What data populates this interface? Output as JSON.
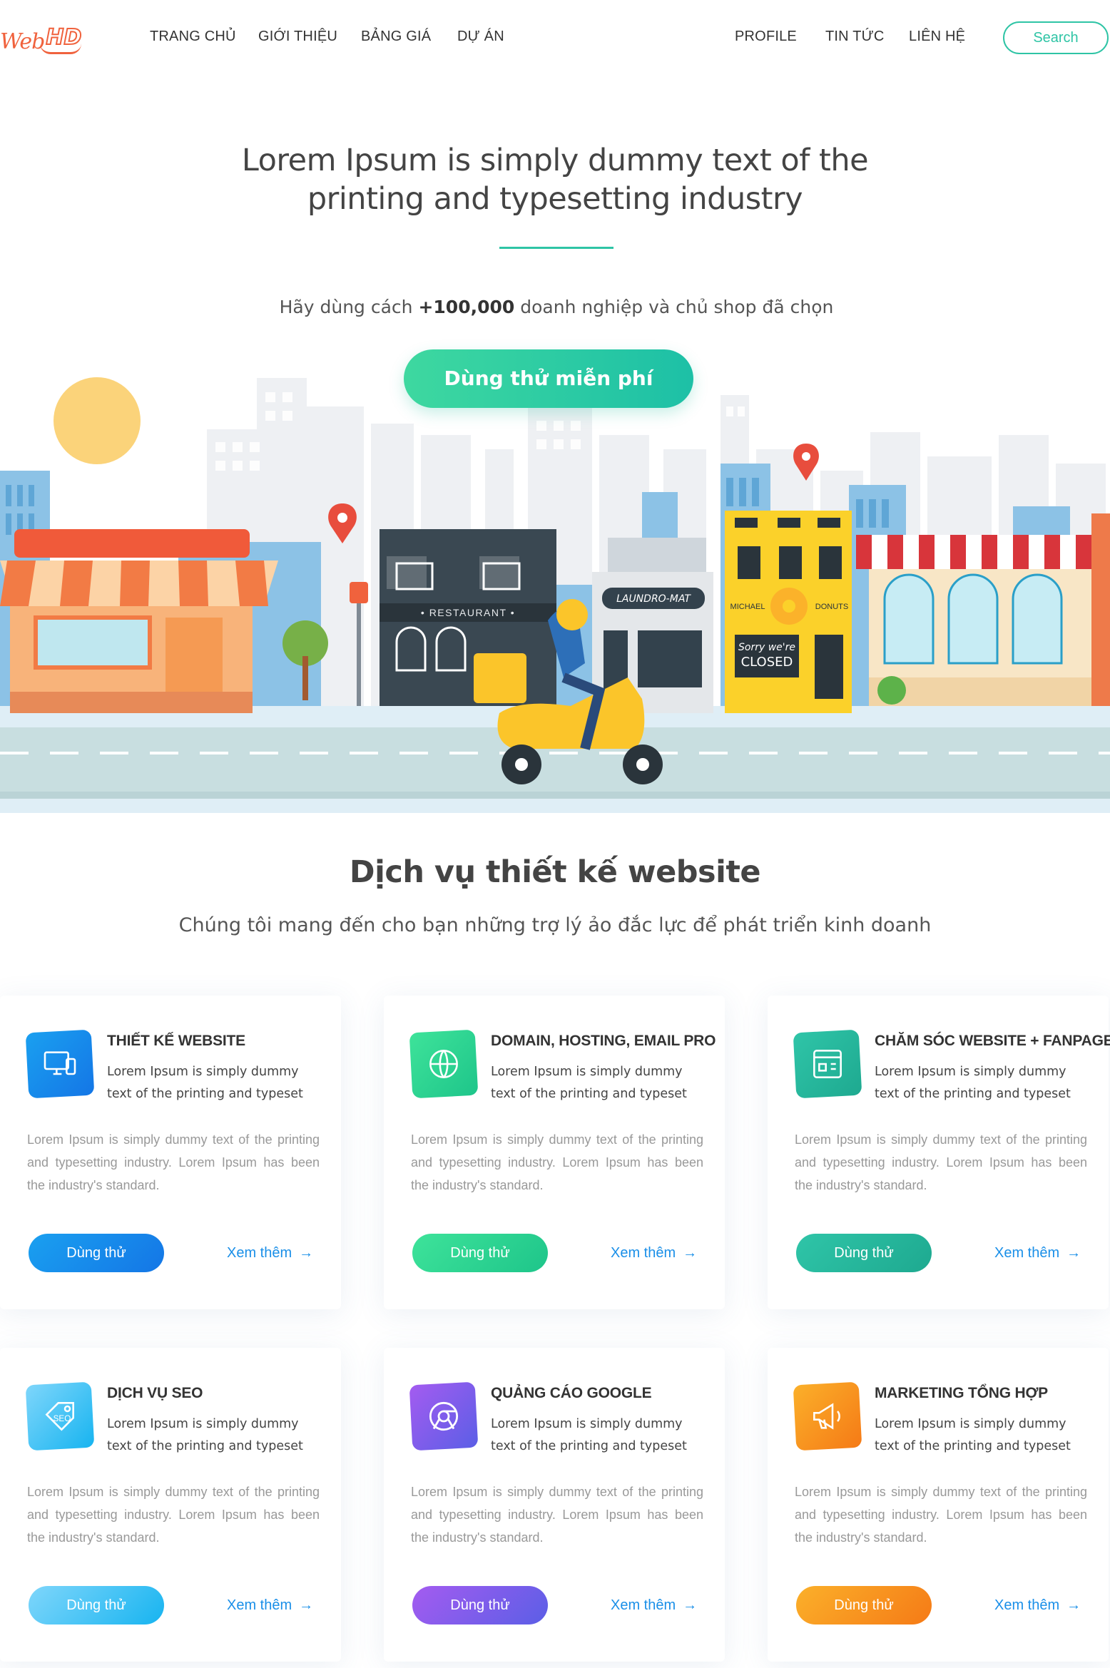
{
  "nav": {
    "logo_web": "Web",
    "logo_hd": "HD",
    "links": [
      "TRANG CHỦ",
      "GIỚI THIỆU",
      "BẢNG GIÁ",
      "DỰ ÁN",
      "PROFILE",
      "TIN TỨC",
      "LIÊN HỆ"
    ],
    "search_label": "Search"
  },
  "hero": {
    "title_line1": "Lorem Ipsum is simply dummy text of the",
    "title_line2": "printing and typesetting industry",
    "subtitle_pre": "Hãy dùng cách ",
    "subtitle_bold": "+100,000",
    "subtitle_post": " doanh nghiệp và chủ shop đã chọn",
    "cta_label": "Dùng thử miễn phí",
    "scene_signs": {
      "restaurant": "• RESTAURANT •",
      "laundromat": "LAUNDRO-MAT",
      "donut_left": "MICHAEL",
      "donut_right": "DONUTS",
      "closed_top": "Sorry we're",
      "closed_main": "CLOSED"
    }
  },
  "services": {
    "title": "Dịch vụ thiết kế website",
    "subtitle": "Chúng tôi mang đến cho bạn những trợ lý ảo đắc lực để phát triển kinh doanh",
    "cards": [
      {
        "title": "THIẾT KẾ WEBSITE",
        "icon": "monitor-icon",
        "lead": "Lorem Ipsum is simply dummy text of the printing and typeset",
        "body": "Lorem Ipsum is simply dummy text of the printing and typesetting industry. Lorem Ipsum has been the industry's standard.",
        "button": "Dùng thử",
        "more": "Xem thêm",
        "color_a": "#1aa0f0",
        "color_b": "#1476e6"
      },
      {
        "title": "DOMAIN, HOSTING, EMAIL PRO",
        "icon": "globe-icon",
        "lead": "Lorem Ipsum is simply dummy text of the printing and typeset",
        "body": "Lorem Ipsum is simply dummy text of the printing and typesetting industry. Lorem Ipsum has been the industry's standard.",
        "button": "Dùng thử",
        "more": "Xem thêm",
        "color_a": "#3ee39a",
        "color_b": "#1ec58a"
      },
      {
        "title": "CHĂM SÓC WEBSITE + FANPAGE",
        "icon": "dashboard-icon",
        "lead": "Lorem Ipsum is simply dummy text of the printing and typeset",
        "body": "Lorem Ipsum is simply dummy text of the printing and typesetting industry. Lorem Ipsum has been the industry's standard.",
        "button": "Dùng thử",
        "more": "Xem thêm",
        "color_a": "#2fc5a8",
        "color_b": "#1ea990"
      },
      {
        "title": "DỊCH VỤ SEO",
        "icon": "seo-tag-icon",
        "lead": "Lorem Ipsum is simply dummy text of the printing and typeset",
        "body": "Lorem Ipsum is simply dummy text of the printing and typesetting industry. Lorem Ipsum has been the industry's standard.",
        "button": "Dùng thử",
        "more": "Xem thêm",
        "color_a": "#7fd6fb",
        "color_b": "#17b4f0"
      },
      {
        "title": "QUẢNG CÁO GOOGLE",
        "icon": "chrome-icon",
        "lead": "Lorem Ipsum is simply dummy text of the printing and typeset",
        "body": "Lorem Ipsum is simply dummy text of the printing and typesetting industry. Lorem Ipsum has been the industry's standard.",
        "button": "Dùng thử",
        "more": "Xem thêm",
        "color_a": "#a45cf0",
        "color_b": "#5b5ee6"
      },
      {
        "title": "MARKETING TỔNG HỢP",
        "icon": "megaphone-icon",
        "lead": "Lorem Ipsum is simply dummy text of the printing and typeset",
        "body": "Lorem Ipsum is simply dummy text of the printing and typesetting industry. Lorem Ipsum has been the industry's standard.",
        "button": "Dùng thử",
        "more": "Xem thêm",
        "color_a": "#fbb02a",
        "color_b": "#f57a16"
      }
    ]
  },
  "colors": {
    "accent": "#2ec4a5",
    "logo": "#f0623d",
    "link": "#1a8fe8"
  }
}
